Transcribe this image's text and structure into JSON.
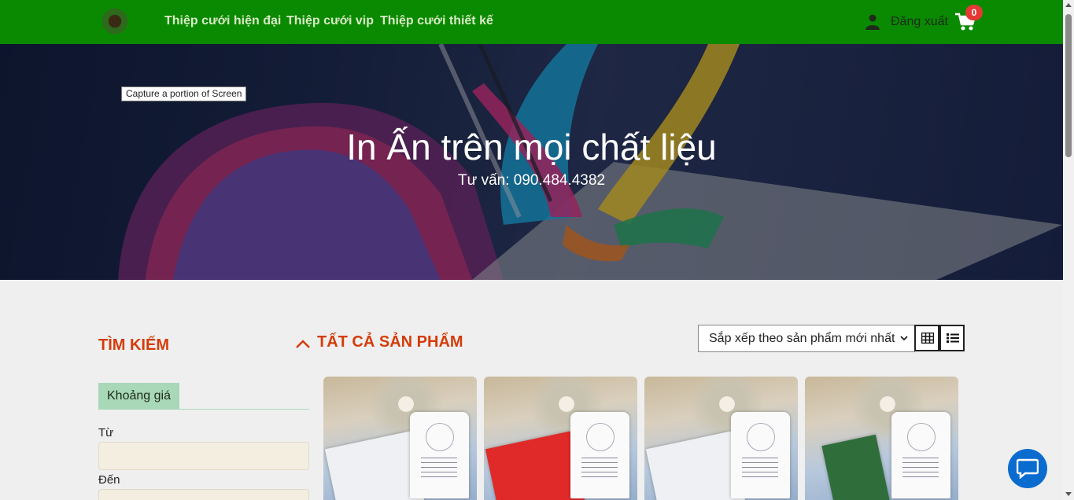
{
  "header": {
    "nav": [
      "Thiệp cưới hiện đại",
      "Thiệp cưới vip",
      "Thiệp cưới thiết kế"
    ],
    "logout_label": "Đăng xuất",
    "cart_count": "0"
  },
  "hero": {
    "tooltip": "Capture a portion of Screen",
    "title": "In Ấn trên mọi chất liệu",
    "subtitle": "Tư vấn: 090.484.4382"
  },
  "sidebar": {
    "title": "TÌM KIẾM",
    "price_tab": "Khoảng giá",
    "from_label": "Từ",
    "to_label": "Đến"
  },
  "products": {
    "title": "TẤT CẢ SẢN PHẨM",
    "sort_selected": "Sắp xếp theo sản phẩm mới nhất"
  },
  "colors": {
    "navbar": "#0a8a00",
    "accent": "#d43c0a",
    "chat": "#0a6ccf"
  }
}
